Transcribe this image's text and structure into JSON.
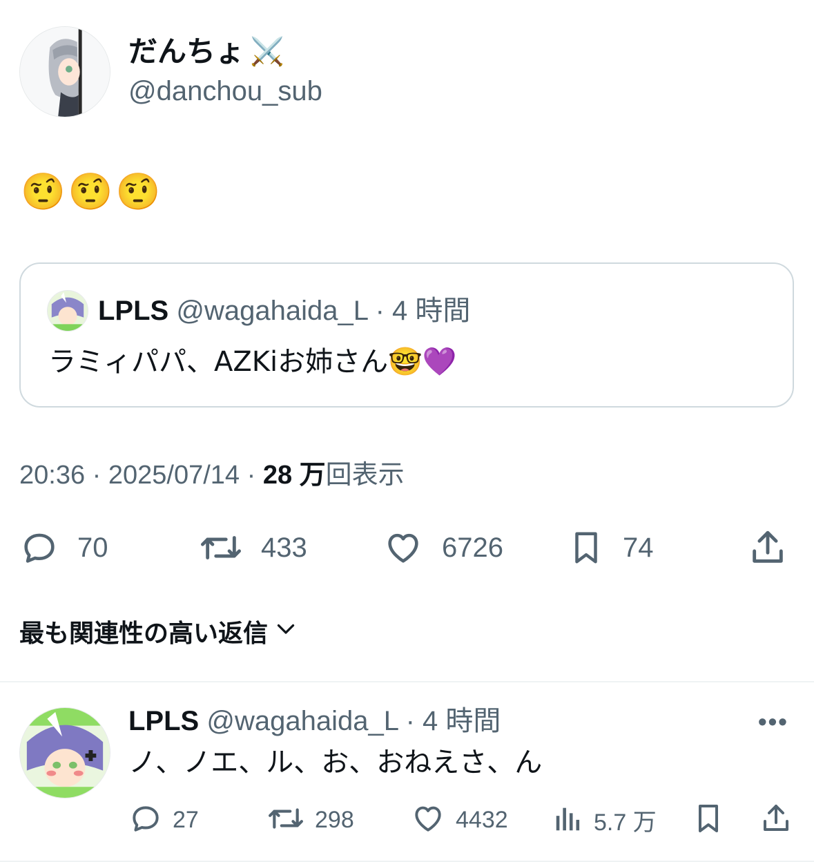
{
  "author": {
    "name": "だんちょ",
    "name_emoji": "⚔️",
    "handle": "@danchou_sub"
  },
  "tweet": {
    "text": "🤨🤨🤨"
  },
  "quote": {
    "name": "LPLS",
    "handle": "@wagahaida_L",
    "separator": " · ",
    "time": "4 時間",
    "text": "ラミィパパ、AZKiお姉さん🤓💜"
  },
  "meta": {
    "time": "20:36",
    "date": "2025/07/14",
    "sep": " · ",
    "views_count": "28 万",
    "views_label": "回表示"
  },
  "actions": {
    "replies": "70",
    "reposts": "433",
    "likes": "6726",
    "bookmarks": "74"
  },
  "sort": {
    "label": "最も関連性の高い返信"
  },
  "reply": {
    "name": "LPLS",
    "handle": "@wagahaida_L",
    "separator": " · ",
    "time": "4 時間",
    "more": "•••",
    "text": "ノ、ノエ、ル、お、おねえさ、ん",
    "replies": "27",
    "reposts": "298",
    "likes": "4432",
    "views": "5.7 万"
  },
  "icons": [
    "reply-icon",
    "repost-icon",
    "like-icon",
    "bookmark-icon",
    "share-icon",
    "views-icon",
    "chevron-down-icon",
    "more-icon"
  ],
  "colors": {
    "text": "#0f1419",
    "secondary": "#536471",
    "border": "#cfd9de"
  }
}
